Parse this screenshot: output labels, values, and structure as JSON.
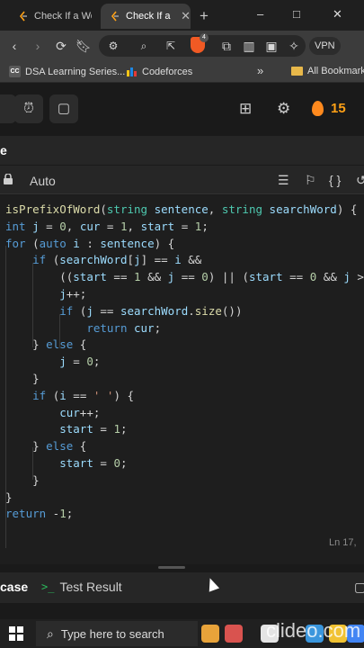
{
  "browser": {
    "tabs": [
      {
        "label": "Check If a Wor",
        "active": false
      },
      {
        "label": "Check If a",
        "active": true
      }
    ],
    "new_tab": "+",
    "window_controls": [
      "–",
      "□",
      "✕"
    ],
    "vpn_label": "VPN",
    "brave_badge": "4"
  },
  "bookmarks": [
    {
      "icon": "cc",
      "label": "DSA Learning Series..."
    },
    {
      "icon": "cf",
      "label": "Codeforces"
    },
    {
      "icon": "folder",
      "label": "All Bookmarks"
    }
  ],
  "bookmarks_more": "»",
  "header": {
    "streak_count": "15"
  },
  "panel_title": "e",
  "editor": {
    "language": "Auto",
    "cursor_position": "Ln 17,"
  },
  "bottom_tabs": {
    "case_label": "case",
    "test_result_label": "Test Result",
    "test_prompt_glyph": ">_"
  },
  "taskbar": {
    "search_placeholder": "Type here to search"
  },
  "watermark": "clideo.com",
  "colors": {
    "accent_orange": "#ffa116",
    "keyword": "#569cd6",
    "type": "#4ec9b0",
    "function": "#dcdcaa",
    "variable": "#9cdcfe",
    "number": "#b5cea8",
    "string": "#ce9178",
    "test_green": "#2cbb5d"
  },
  "code_lines": [
    [
      {
        "t": "isPrefixOfWord",
        "c": "fn"
      },
      {
        "t": "(",
        "c": ""
      },
      {
        "t": "string",
        "c": "ty"
      },
      {
        "t": " ",
        "c": ""
      },
      {
        "t": "sentence",
        "c": "id"
      },
      {
        "t": ", ",
        "c": ""
      },
      {
        "t": "string",
        "c": "ty"
      },
      {
        "t": " ",
        "c": ""
      },
      {
        "t": "searchWord",
        "c": "id"
      },
      {
        "t": ") {",
        "c": ""
      }
    ],
    [
      {
        "t": "int",
        "c": "kw"
      },
      {
        "t": " ",
        "c": ""
      },
      {
        "t": "j",
        "c": "id"
      },
      {
        "t": " = ",
        "c": ""
      },
      {
        "t": "0",
        "c": "nm"
      },
      {
        "t": ", ",
        "c": ""
      },
      {
        "t": "cur",
        "c": "id"
      },
      {
        "t": " = ",
        "c": ""
      },
      {
        "t": "1",
        "c": "nm"
      },
      {
        "t": ", ",
        "c": ""
      },
      {
        "t": "start",
        "c": "id"
      },
      {
        "t": " = ",
        "c": ""
      },
      {
        "t": "1",
        "c": "nm"
      },
      {
        "t": ";",
        "c": ""
      }
    ],
    [
      {
        "t": "for",
        "c": "kw"
      },
      {
        "t": " (",
        "c": ""
      },
      {
        "t": "auto",
        "c": "kw"
      },
      {
        "t": " ",
        "c": ""
      },
      {
        "t": "i",
        "c": "id"
      },
      {
        "t": " : ",
        "c": ""
      },
      {
        "t": "sentence",
        "c": "id"
      },
      {
        "t": ") {",
        "c": ""
      }
    ],
    [
      {
        "t": "    ",
        "c": ""
      },
      {
        "t": "if",
        "c": "kw"
      },
      {
        "t": " (",
        "c": ""
      },
      {
        "t": "searchWord",
        "c": "id"
      },
      {
        "t": "[",
        "c": ""
      },
      {
        "t": "j",
        "c": "id"
      },
      {
        "t": "] == ",
        "c": ""
      },
      {
        "t": "i",
        "c": "id"
      },
      {
        "t": " &&",
        "c": ""
      }
    ],
    [
      {
        "t": "        ((",
        "c": ""
      },
      {
        "t": "start",
        "c": "id"
      },
      {
        "t": " == ",
        "c": ""
      },
      {
        "t": "1",
        "c": "nm"
      },
      {
        "t": " && ",
        "c": ""
      },
      {
        "t": "j",
        "c": "id"
      },
      {
        "t": " == ",
        "c": ""
      },
      {
        "t": "0",
        "c": "nm"
      },
      {
        "t": ") || (",
        "c": ""
      },
      {
        "t": "start",
        "c": "id"
      },
      {
        "t": " == ",
        "c": ""
      },
      {
        "t": "0",
        "c": "nm"
      },
      {
        "t": " && ",
        "c": ""
      },
      {
        "t": "j",
        "c": "id"
      },
      {
        "t": " >",
        "c": ""
      }
    ],
    [
      {
        "t": "        ",
        "c": ""
      },
      {
        "t": "j",
        "c": "id"
      },
      {
        "t": "++;",
        "c": ""
      }
    ],
    [
      {
        "t": "        ",
        "c": ""
      },
      {
        "t": "if",
        "c": "kw"
      },
      {
        "t": " (",
        "c": ""
      },
      {
        "t": "j",
        "c": "id"
      },
      {
        "t": " == ",
        "c": ""
      },
      {
        "t": "searchWord",
        "c": "id"
      },
      {
        "t": ".",
        "c": ""
      },
      {
        "t": "size",
        "c": "fn"
      },
      {
        "t": "())",
        "c": ""
      }
    ],
    [
      {
        "t": "            ",
        "c": ""
      },
      {
        "t": "return",
        "c": "kw"
      },
      {
        "t": " ",
        "c": ""
      },
      {
        "t": "cur",
        "c": "id"
      },
      {
        "t": ";",
        "c": ""
      }
    ],
    [
      {
        "t": "    } ",
        "c": ""
      },
      {
        "t": "else",
        "c": "kw"
      },
      {
        "t": " {",
        "c": ""
      }
    ],
    [
      {
        "t": "        ",
        "c": ""
      },
      {
        "t": "j",
        "c": "id"
      },
      {
        "t": " = ",
        "c": ""
      },
      {
        "t": "0",
        "c": "nm"
      },
      {
        "t": ";",
        "c": ""
      }
    ],
    [
      {
        "t": "    }",
        "c": ""
      }
    ],
    [
      {
        "t": "    ",
        "c": ""
      },
      {
        "t": "if",
        "c": "kw"
      },
      {
        "t": " (",
        "c": ""
      },
      {
        "t": "i",
        "c": "id"
      },
      {
        "t": " == ",
        "c": ""
      },
      {
        "t": "' '",
        "c": "st"
      },
      {
        "t": ") {",
        "c": ""
      }
    ],
    [
      {
        "t": "        ",
        "c": ""
      },
      {
        "t": "cur",
        "c": "id"
      },
      {
        "t": "++;",
        "c": ""
      }
    ],
    [
      {
        "t": "        ",
        "c": ""
      },
      {
        "t": "start",
        "c": "id"
      },
      {
        "t": " = ",
        "c": ""
      },
      {
        "t": "1",
        "c": "nm"
      },
      {
        "t": ";",
        "c": ""
      }
    ],
    [
      {
        "t": "    } ",
        "c": ""
      },
      {
        "t": "else",
        "c": "kw"
      },
      {
        "t": " {",
        "c": ""
      }
    ],
    [
      {
        "t": "        ",
        "c": ""
      },
      {
        "t": "start",
        "c": "id"
      },
      {
        "t": " = ",
        "c": ""
      },
      {
        "t": "0",
        "c": "nm"
      },
      {
        "t": ";",
        "c": ""
      }
    ],
    [
      {
        "t": "    }",
        "c": ""
      }
    ],
    [
      {
        "t": "}",
        "c": ""
      }
    ],
    [
      {
        "t": "return",
        "c": "kw"
      },
      {
        "t": " -",
        "c": ""
      },
      {
        "t": "1",
        "c": "nm"
      },
      {
        "t": ";",
        "c": ""
      }
    ]
  ]
}
